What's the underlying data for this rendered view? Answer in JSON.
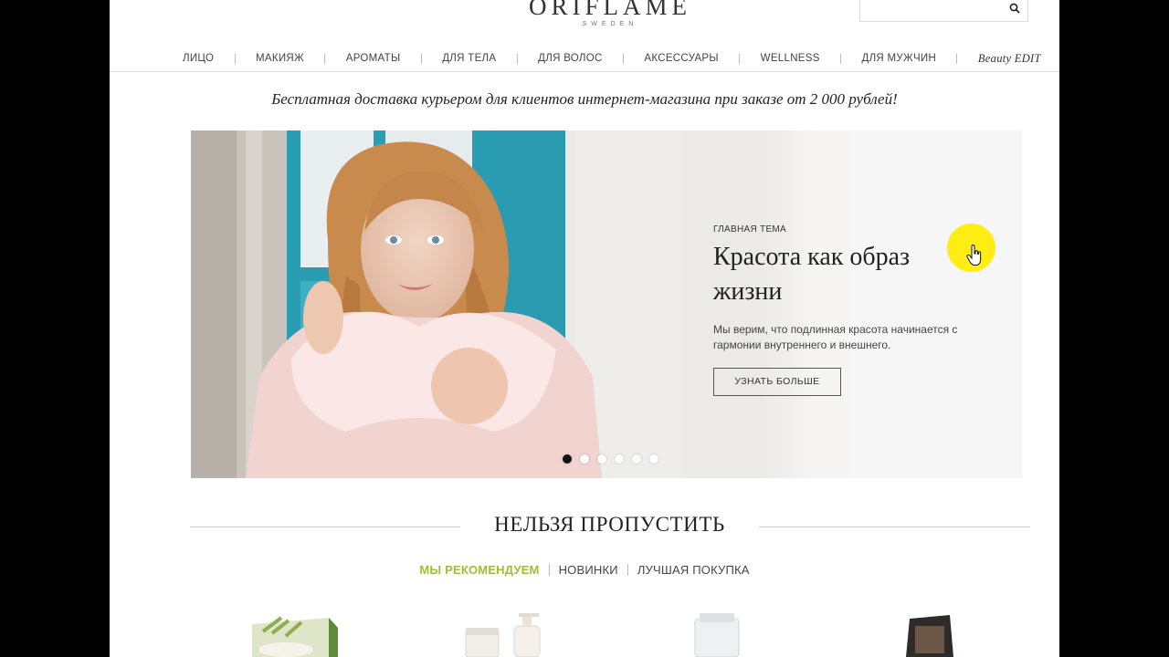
{
  "header": {
    "logo_name": "ORIFLAME",
    "logo_sub": "SWEDEN",
    "search_placeholder": ""
  },
  "nav": {
    "items": [
      "ЛИЦО",
      "МАКИЯЖ",
      "АРОМАТЫ",
      "ДЛЯ ТЕЛА",
      "ДЛЯ ВОЛОС",
      "АКСЕССУАРЫ",
      "WELLNESS",
      "ДЛЯ МУЖЧИН"
    ],
    "beauty_edit": "Beauty EDIT"
  },
  "promo": "Бесплатная доставка курьером для клиентов интернет-магазина при заказе от 2 000 рублей!",
  "hero": {
    "eyebrow": "ГЛАВНАЯ ТЕМА",
    "title": "Красота как образ жизни",
    "description": "Мы верим, что подлинная красота начинается с гармонии внутреннего и внешнего.",
    "button": "УЗНАТЬ БОЛЬШЕ",
    "slides_total": 6,
    "active_slide": 1
  },
  "section": {
    "heading": "НЕЛЬЗЯ ПРОПУСТИТЬ",
    "tabs": [
      "МЫ РЕКОМЕНДУЕМ",
      "НОВИНКИ",
      "ЛУЧШАЯ ПОКУПКА"
    ],
    "active_tab": 0
  },
  "colors": {
    "accent_green": "#9bbf3a",
    "cursor_highlight": "#ffeb00"
  }
}
